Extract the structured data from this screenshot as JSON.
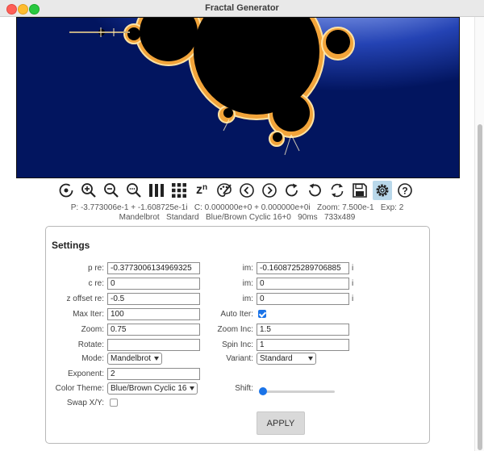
{
  "window": {
    "title": "Fractal Generator"
  },
  "toolbar": {
    "buttons": [
      {
        "name": "reset-icon"
      },
      {
        "name": "zoom-in-icon"
      },
      {
        "name": "zoom-out-icon"
      },
      {
        "name": "zoom-custom-icon"
      },
      {
        "name": "columns-icon"
      },
      {
        "name": "grid-icon"
      },
      {
        "name": "power-icon",
        "label": "z",
        "sup": "n"
      },
      {
        "name": "palette-icon"
      },
      {
        "name": "prev-icon"
      },
      {
        "name": "next-icon"
      },
      {
        "name": "rotate-cw-icon"
      },
      {
        "name": "rotate-ccw-icon"
      },
      {
        "name": "refresh-icon"
      },
      {
        "name": "save-icon"
      },
      {
        "name": "settings-icon",
        "active": true
      },
      {
        "name": "help-icon"
      }
    ]
  },
  "status": {
    "line1": "P: -3.773006e-1 + -1.608725e-1i   C: 0.000000e+0 + 0.000000e+0i   Zoom: 7.500e-1   Exp: 2",
    "line2": "Mandelbrot   Standard   Blue/Brown Cyclic 16+0   90ms   733x489"
  },
  "settings": {
    "title": "Settings",
    "p_re": {
      "label": "p re:",
      "value": "-0.3773006134969325"
    },
    "p_im": {
      "label": "im:",
      "value": "-0.1608725289706885",
      "suffix": "i"
    },
    "c_re": {
      "label": "c re:",
      "value": "0"
    },
    "c_im": {
      "label": "im:",
      "value": "0",
      "suffix": "i"
    },
    "z_offset_re": {
      "label": "z offset re:",
      "value": "-0.5"
    },
    "z_offset_im": {
      "label": "im:",
      "value": "0",
      "suffix": "i"
    },
    "max_iter": {
      "label": "Max Iter:",
      "value": "100"
    },
    "auto_iter": {
      "label": "Auto Iter:",
      "checked": true
    },
    "zoom": {
      "label": "Zoom:",
      "value": "0.75"
    },
    "zoom_inc": {
      "label": "Zoom Inc:",
      "value": "1.5"
    },
    "rotate": {
      "label": "Rotate:",
      "value": ""
    },
    "spin_inc": {
      "label": "Spin Inc:",
      "value": "1"
    },
    "mode": {
      "label": "Mode:",
      "value": "Mandelbrot"
    },
    "variant": {
      "label": "Variant:",
      "value": "Standard"
    },
    "exponent": {
      "label": "Exponent:",
      "value": "2"
    },
    "color_theme": {
      "label": "Color Theme:",
      "value": "Blue/Brown Cyclic 16"
    },
    "shift": {
      "label": "Shift:",
      "level": 0
    },
    "swap_xy": {
      "label": "Swap X/Y:",
      "checked": false
    },
    "apply_label": "APPLY"
  }
}
